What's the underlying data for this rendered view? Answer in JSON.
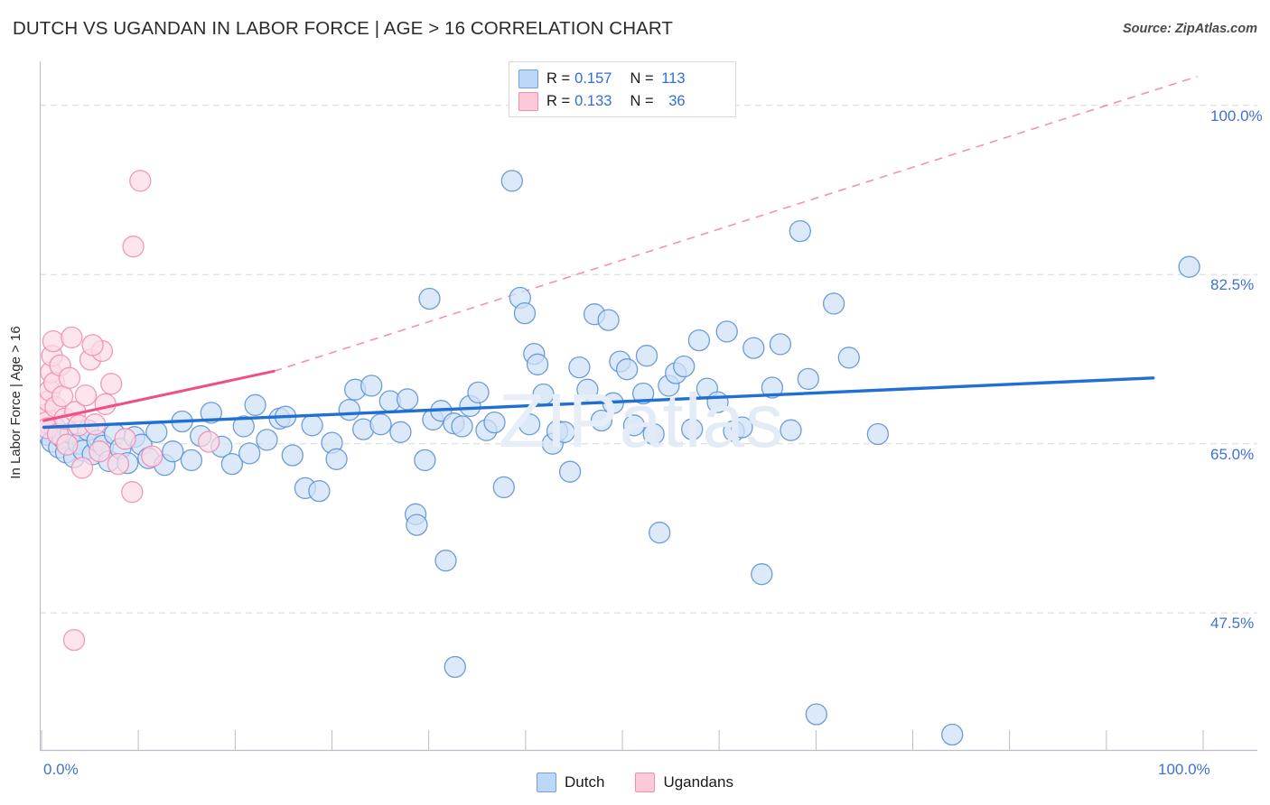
{
  "header": {
    "title": "DUTCH VS UGANDAN IN LABOR FORCE | AGE > 16 CORRELATION CHART",
    "source": "Source: ZipAtlas.com"
  },
  "watermark": {
    "part1": "ZIP",
    "part2": "atlas"
  },
  "correlation_legend": {
    "rows": [
      {
        "series": "Dutch",
        "color": "#bdd7f7",
        "r_label": "R = ",
        "r_value": "0.157",
        "n_label": "N = ",
        "n_value": "113"
      },
      {
        "series": "Ugandans",
        "color": "#fbc9d8",
        "r_label": "R = ",
        "r_value": "0.133",
        "n_label": "N = ",
        "n_value": "36"
      }
    ]
  },
  "bottom_legend": {
    "items": [
      {
        "label": "Dutch",
        "color": "#bdd7f7",
        "border": "#6fa3e0"
      },
      {
        "label": "Ugandans",
        "color": "#fbc9d8",
        "border": "#ef8fae"
      }
    ]
  },
  "colors": {
    "blue_fill": "#cfe0f7",
    "blue_stroke": "#5b8fd4",
    "blue_line": "#1f6fd4",
    "pink_fill": "#fbdbe6",
    "pink_stroke": "#f08bb0",
    "pink_line": "#ef4f82",
    "grid": "#d8d8d8",
    "axis": "#b9bfc9",
    "tick_text": "#3f72d1"
  },
  "chart_data": {
    "type": "scatter",
    "title": "DUTCH VS UGANDAN IN LABOR FORCE | AGE > 16 CORRELATION CHART",
    "xlabel": "",
    "ylabel": "In Labor Force | Age > 16",
    "xlim": [
      0,
      100
    ],
    "ylim": [
      33.5,
      104.0
    ],
    "grid": true,
    "legend_position": "bottom-center",
    "x_ticks": [
      {
        "value": 0,
        "label": "0.0%"
      },
      {
        "value": 100,
        "label": "100.0%"
      }
    ],
    "x_tick_marks": [
      0,
      8.33,
      16.67,
      25,
      33.33,
      41.67,
      50,
      58.33,
      66.67,
      75,
      83.33,
      91.67,
      100
    ],
    "y_ticks": [
      {
        "value": 100.0,
        "label": "100.0%"
      },
      {
        "value": 82.5,
        "label": "82.5%"
      },
      {
        "value": 65.0,
        "label": "65.0%"
      },
      {
        "value": 47.5,
        "label": "47.5%"
      }
    ],
    "series": [
      {
        "name": "Dutch",
        "color": "#cfe0f7",
        "r": 0.157,
        "n": 113,
        "trend": {
          "style": "solid",
          "x0": 0.2,
          "y0": 66.7,
          "x1": 95.7,
          "y1": 71.8
        },
        "points": [
          [
            0.4,
            66.3
          ],
          [
            0.6,
            65.9
          ],
          [
            0.9,
            65.2
          ],
          [
            1.2,
            66.6
          ],
          [
            1.5,
            64.6
          ],
          [
            1.8,
            65.6
          ],
          [
            2.1,
            64.1
          ],
          [
            2.5,
            66.1
          ],
          [
            2.8,
            63.6
          ],
          [
            3.2,
            65.0
          ],
          [
            3.6,
            64.3
          ],
          [
            4.0,
            66.4
          ],
          [
            4.4,
            63.9
          ],
          [
            4.8,
            65.3
          ],
          [
            5.3,
            64.8
          ],
          [
            5.8,
            63.2
          ],
          [
            6.3,
            66.0
          ],
          [
            6.8,
            64.5
          ],
          [
            7.4,
            63.0
          ],
          [
            8.0,
            65.7
          ],
          [
            8.6,
            64.9
          ],
          [
            9.2,
            63.5
          ],
          [
            9.9,
            66.2
          ],
          [
            10.6,
            62.8
          ],
          [
            11.3,
            64.2
          ],
          [
            12.1,
            67.3
          ],
          [
            12.9,
            63.3
          ],
          [
            13.7,
            65.8
          ],
          [
            14.6,
            68.2
          ],
          [
            15.5,
            64.7
          ],
          [
            16.4,
            62.9
          ],
          [
            17.4,
            66.8
          ],
          [
            18.4,
            69.0
          ],
          [
            19.4,
            65.4
          ],
          [
            20.5,
            67.6
          ],
          [
            21.6,
            63.8
          ],
          [
            22.7,
            60.4
          ],
          [
            23.3,
            66.9
          ],
          [
            23.9,
            60.1
          ],
          [
            25.0,
            65.1
          ],
          [
            25.4,
            63.4
          ],
          [
            26.5,
            68.5
          ],
          [
            27.0,
            70.6
          ],
          [
            27.7,
            66.5
          ],
          [
            28.4,
            71.0
          ],
          [
            29.2,
            67.0
          ],
          [
            30.0,
            69.4
          ],
          [
            30.9,
            66.2
          ],
          [
            31.5,
            69.6
          ],
          [
            32.2,
            57.7
          ],
          [
            32.3,
            56.6
          ],
          [
            33.0,
            63.3
          ],
          [
            33.4,
            80.0
          ],
          [
            33.7,
            67.5
          ],
          [
            34.4,
            68.4
          ],
          [
            34.8,
            52.9
          ],
          [
            35.5,
            67.1
          ],
          [
            35.6,
            41.9
          ],
          [
            36.2,
            66.8
          ],
          [
            36.9,
            68.9
          ],
          [
            37.6,
            70.3
          ],
          [
            38.3,
            66.4
          ],
          [
            39.0,
            67.2
          ],
          [
            39.8,
            60.5
          ],
          [
            40.5,
            92.2
          ],
          [
            41.2,
            80.1
          ],
          [
            41.6,
            78.5
          ],
          [
            42.0,
            67.0
          ],
          [
            42.4,
            74.3
          ],
          [
            42.7,
            73.2
          ],
          [
            43.2,
            70.1
          ],
          [
            44.0,
            65.0
          ],
          [
            44.4,
            66.3
          ],
          [
            45.0,
            66.2
          ],
          [
            45.5,
            62.1
          ],
          [
            46.3,
            72.9
          ],
          [
            47.0,
            70.6
          ],
          [
            47.6,
            78.4
          ],
          [
            48.2,
            67.4
          ],
          [
            48.8,
            77.8
          ],
          [
            49.2,
            69.2
          ],
          [
            49.8,
            73.5
          ],
          [
            50.4,
            72.7
          ],
          [
            51.0,
            66.9
          ],
          [
            51.8,
            70.2
          ],
          [
            52.1,
            74.1
          ],
          [
            52.7,
            66.0
          ],
          [
            53.2,
            55.8
          ],
          [
            54.0,
            71.0
          ],
          [
            54.6,
            72.3
          ],
          [
            55.3,
            73.0
          ],
          [
            56.0,
            66.5
          ],
          [
            56.6,
            75.7
          ],
          [
            57.3,
            70.7
          ],
          [
            58.2,
            69.3
          ],
          [
            59.0,
            76.6
          ],
          [
            59.6,
            66.3
          ],
          [
            60.3,
            66.7
          ],
          [
            61.3,
            74.9
          ],
          [
            62.0,
            51.5
          ],
          [
            62.9,
            70.8
          ],
          [
            63.6,
            75.3
          ],
          [
            64.5,
            66.4
          ],
          [
            65.3,
            87.0
          ],
          [
            66.0,
            71.7
          ],
          [
            66.7,
            37.0
          ],
          [
            68.2,
            79.5
          ],
          [
            69.5,
            73.9
          ],
          [
            72.0,
            66.0
          ],
          [
            78.4,
            34.9
          ],
          [
            98.8,
            83.3
          ],
          [
            21.0,
            67.8
          ],
          [
            17.9,
            64.0
          ]
        ]
      },
      {
        "name": "Ugandans",
        "color": "#fbdbe6",
        "r": 0.133,
        "n": 36,
        "trend": {
          "style": "solid",
          "x0": 0.2,
          "y0": 67.4,
          "x1": 20.0,
          "y1": 72.5
        },
        "trend_extension": {
          "style": "dashed",
          "x0": 20.0,
          "y0": 72.5,
          "x1": 99.5,
          "y1": 103.0
        },
        "points": [
          [
            0.3,
            68.0
          ],
          [
            0.4,
            67.2
          ],
          [
            0.5,
            66.6
          ],
          [
            0.6,
            69.4
          ],
          [
            0.7,
            70.5
          ],
          [
            0.8,
            72.4
          ],
          [
            0.9,
            74.1
          ],
          [
            1.0,
            75.6
          ],
          [
            1.1,
            71.3
          ],
          [
            1.2,
            68.8
          ],
          [
            1.4,
            66.0
          ],
          [
            1.6,
            73.1
          ],
          [
            1.8,
            69.9
          ],
          [
            2.0,
            67.6
          ],
          [
            2.2,
            64.9
          ],
          [
            2.4,
            71.8
          ],
          [
            2.6,
            76.0
          ],
          [
            2.9,
            68.3
          ],
          [
            3.2,
            66.9
          ],
          [
            3.5,
            62.5
          ],
          [
            3.8,
            70.0
          ],
          [
            4.2,
            73.7
          ],
          [
            4.6,
            67.0
          ],
          [
            5.0,
            64.2
          ],
          [
            5.5,
            69.1
          ],
          [
            6.0,
            71.2
          ],
          [
            6.6,
            62.9
          ],
          [
            7.2,
            65.5
          ],
          [
            7.8,
            60.0
          ],
          [
            5.2,
            74.6
          ],
          [
            8.5,
            92.2
          ],
          [
            7.9,
            85.4
          ],
          [
            2.8,
            44.7
          ],
          [
            14.4,
            65.2
          ],
          [
            9.5,
            63.7
          ],
          [
            4.4,
            75.2
          ]
        ]
      }
    ]
  }
}
